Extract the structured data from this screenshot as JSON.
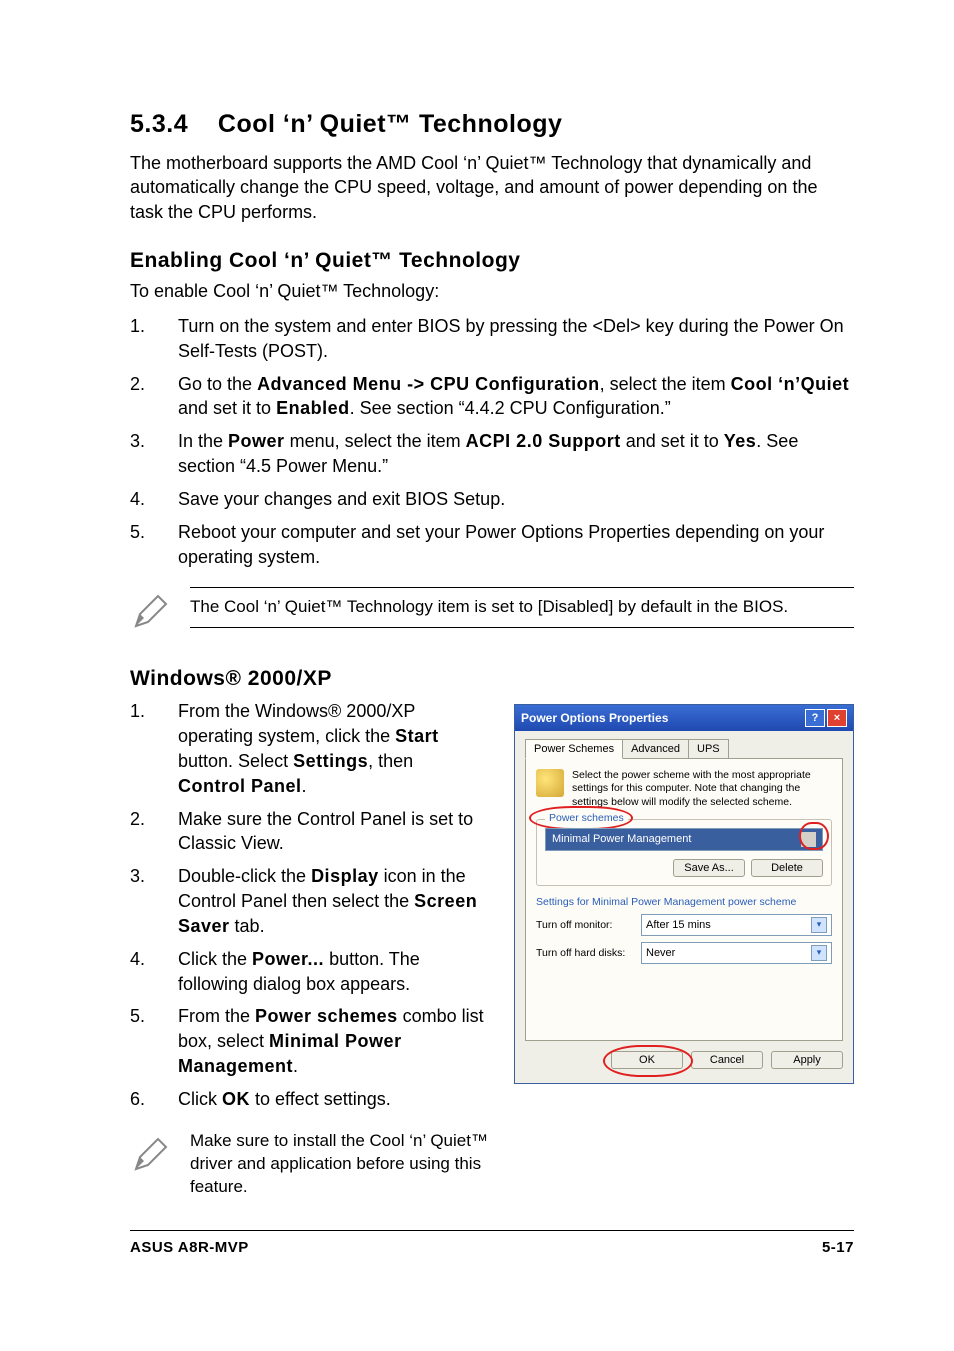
{
  "section": {
    "number": "5.3.4",
    "title": "Cool ‘n’ Quiet™ Technology",
    "intro": "The motherboard supports the AMD Cool ‘n’ Quiet™ Technology that dynamically and automatically change the CPU speed, voltage, and amount of power depending on the task the CPU performs."
  },
  "enable": {
    "heading": "Enabling Cool ‘n’ Quiet™ Technology",
    "lead": "To enable Cool ‘n’ Quiet™ Technology:",
    "steps": [
      {
        "n": "1.",
        "t": "Turn on the system and enter BIOS by pressing the <Del> key during the Power On Self-Tests (POST)."
      },
      {
        "n": "2.",
        "pre": "Go to the ",
        "b1": "Advanced Menu -> CPU Configuration",
        "mid1": ", select the item ",
        "b2": "Cool ‘n’Quiet",
        "mid2": " and set it to ",
        "b3": "Enabled",
        "post": ". See section “4.4.2 CPU Configuration.”"
      },
      {
        "n": "3.",
        "pre": "In the ",
        "b1": "Power",
        "mid1": " menu, select the item ",
        "b2": "ACPI 2.0 Support",
        "mid2": " and set it to ",
        "b3": "Yes",
        "post": ". See section “4.5 Power Menu.”"
      },
      {
        "n": "4.",
        "t": "Save your changes and exit  BIOS Setup."
      },
      {
        "n": "5.",
        "t": "Reboot your computer and set your Power Options Properties depending on your operating system."
      }
    ],
    "note": "The Cool ‘n’ Quiet™ Technology item is set to [Disabled] by default in the BIOS."
  },
  "windows": {
    "heading": "Windows® 2000/XP",
    "steps": [
      {
        "n": "1.",
        "pre": "From the Windows® 2000/XP operating system, click the ",
        "b1": "Start",
        "mid1": " button. Select ",
        "b2": "Settings",
        "mid2": ", then ",
        "b3": "Control Panel",
        "post": "."
      },
      {
        "n": "2.",
        "t": "Make sure the Control Panel is set to Classic View."
      },
      {
        "n": "3.",
        "pre": "Double-click the ",
        "b1": "Display",
        "mid1": " icon in the Control Panel then select the ",
        "b2": "Screen Saver",
        "post": " tab."
      },
      {
        "n": "4.",
        "pre": "Click the ",
        "b1": "Power...",
        "post": " button. The following dialog box appears."
      },
      {
        "n": "5.",
        "pre": "From the ",
        "b1": "Power schemes",
        "mid1": " combo list box, select ",
        "b2": "Minimal Power Management",
        "post": "."
      },
      {
        "n": "6.",
        "pre": "Click ",
        "b1": "OK",
        "post": " to effect settings."
      }
    ],
    "note": "Make sure to install the Cool ‘n’ Quiet™ driver and application before using this feature."
  },
  "dialog": {
    "title": "Power Options Properties",
    "tabs": [
      "Power Schemes",
      "Advanced",
      "UPS"
    ],
    "desc": "Select the power scheme with the most appropriate settings for this computer. Note that changing the settings below will modify the selected scheme.",
    "group_legend": "Power schemes",
    "scheme_selected": "Minimal Power Management",
    "save_as": "Save As...",
    "delete": "Delete",
    "settings_title": "Settings for Minimal Power Management power scheme",
    "turn_off_monitor_label": "Turn off monitor:",
    "turn_off_monitor_value": "After 15 mins",
    "turn_off_hd_label": "Turn off hard disks:",
    "turn_off_hd_value": "Never",
    "ok": "OK",
    "cancel": "Cancel",
    "apply": "Apply"
  },
  "footer": {
    "left": "ASUS A8R-MVP",
    "right": "5-17"
  }
}
